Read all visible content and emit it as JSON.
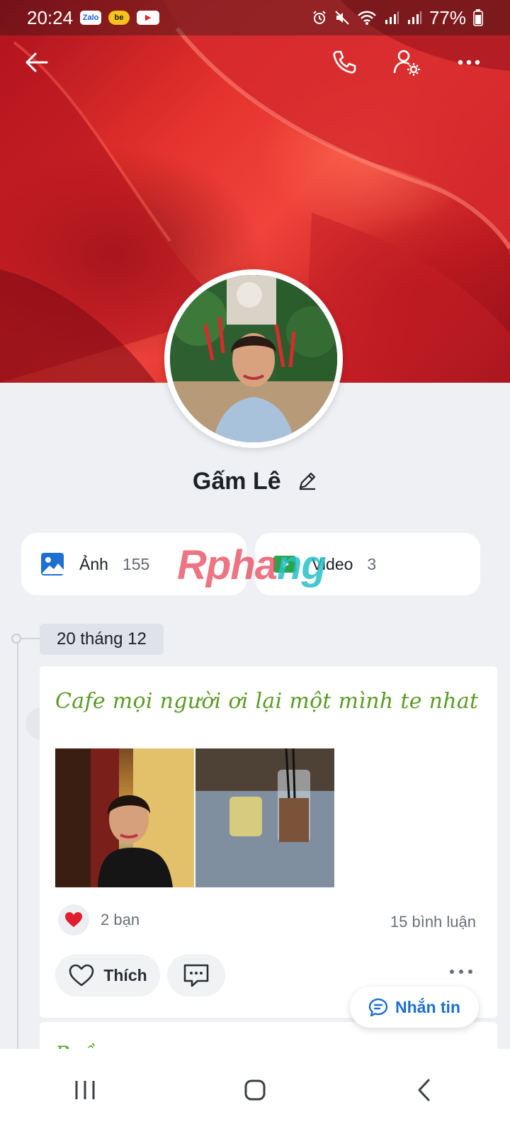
{
  "status_bar": {
    "time": "20:24",
    "apps": [
      "Zalo",
      "be",
      "youtube-icon"
    ],
    "battery": "77%"
  },
  "toolbar": {
    "back": "arrow-left-icon",
    "call": "phone-icon",
    "settings": "user-settings-icon",
    "more": "more-horizontal-icon"
  },
  "profile": {
    "name": "Gấm Lê"
  },
  "media": {
    "photos_label": "Ảnh",
    "photos_count": "155",
    "videos_label": "Video",
    "videos_count": "3"
  },
  "watermark": {
    "text_a": "Rpha",
    "text_b": "ng"
  },
  "timeline": {
    "date": "20 tháng 12"
  },
  "post": {
    "text": "Cafe mọi người ơi lại một mình te nhat",
    "reactions": "2 bạn",
    "comments": "15 bình luận",
    "like_label": "Thích"
  },
  "next_post": {
    "text": "Buồn"
  },
  "chat_button": {
    "label": "Nhắn tin"
  },
  "colors": {
    "accent": "#1d6fd1",
    "post_text": "#5a9b25",
    "heart": "#e01e2e"
  }
}
